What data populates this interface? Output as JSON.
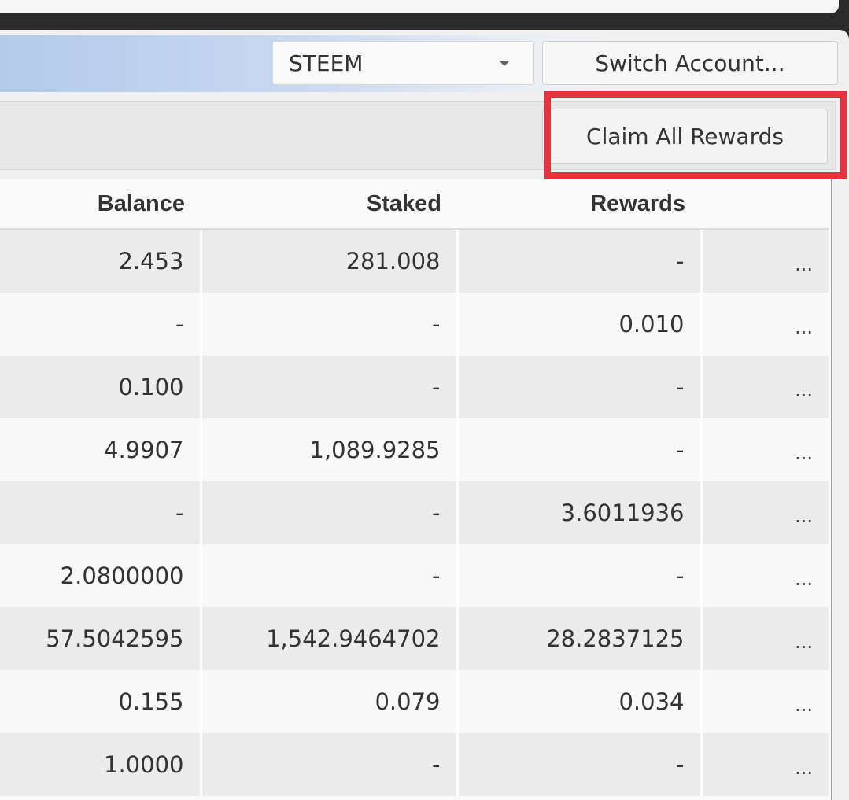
{
  "account": {
    "selected_chain": "STEEM",
    "switch_label": "Switch Account..."
  },
  "toolbar": {
    "claim_label": "Claim All Rewards"
  },
  "table": {
    "headers": [
      "Balance",
      "Staked",
      "Rewards",
      ""
    ],
    "rows": [
      {
        "balance": "2.453",
        "staked": "281.008",
        "rewards": "-",
        "more": "..."
      },
      {
        "balance": "-",
        "staked": "-",
        "rewards": "0.010",
        "more": "..."
      },
      {
        "balance": "0.100",
        "staked": "-",
        "rewards": "-",
        "more": "..."
      },
      {
        "balance": "4.9907",
        "staked": "1,089.9285",
        "rewards": "-",
        "more": "..."
      },
      {
        "balance": "-",
        "staked": "-",
        "rewards": "3.6011936",
        "more": "..."
      },
      {
        "balance": "2.0800000",
        "staked": "-",
        "rewards": "-",
        "more": "..."
      },
      {
        "balance": "57.5042595",
        "staked": "1,542.9464702",
        "rewards": "28.2837125",
        "more": "..."
      },
      {
        "balance": "0.155",
        "staked": "0.079",
        "rewards": "0.034",
        "more": "..."
      },
      {
        "balance": "1.0000",
        "staked": "-",
        "rewards": "-",
        "more": "..."
      }
    ]
  },
  "colors": {
    "highlight": "#e3353b",
    "account_bar_start": "#b4cbec"
  }
}
